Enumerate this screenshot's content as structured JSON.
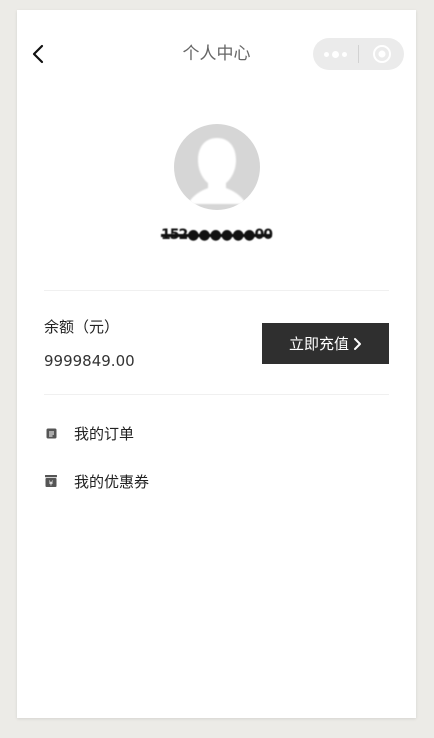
{
  "navbar": {
    "title": "个人中心",
    "back_icon": "chevron-left-icon",
    "capsule": {
      "more_icon": "more-dots-icon",
      "close_icon": "target-circle-icon"
    }
  },
  "profile": {
    "avatar_icon": "user-avatar-icon",
    "phone": "152●●●●●●00"
  },
  "balance": {
    "label": "余额（元）",
    "value": "9999849.00",
    "recharge_label": "立即充值"
  },
  "menu": {
    "items": [
      {
        "label": "我的订单",
        "icon": "order-list-icon"
      },
      {
        "label": "我的优惠券",
        "icon": "coupon-icon"
      }
    ]
  },
  "colors": {
    "page_bg": "#ecebe7",
    "card_bg": "#ffffff",
    "button_bg": "#2f2f2f",
    "capsule_bg": "#ebebeb",
    "avatar_bg": "#d6d6d6"
  }
}
